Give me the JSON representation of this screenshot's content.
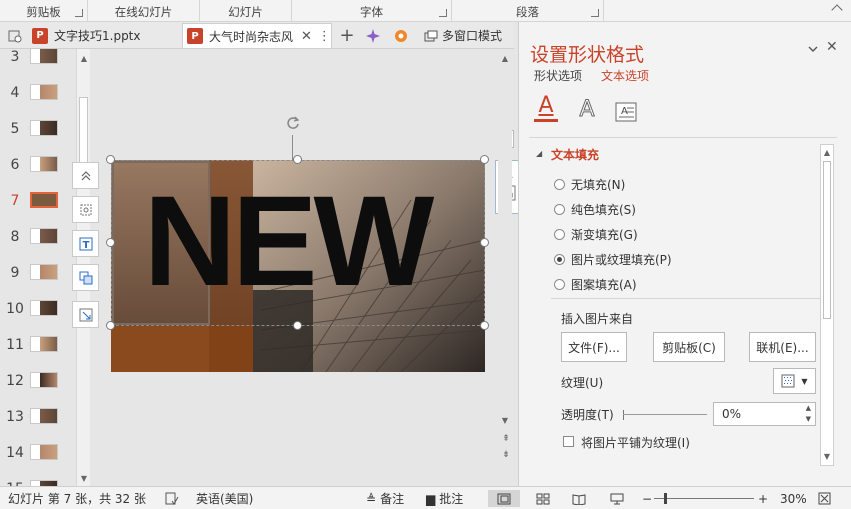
{
  "ribbon": {
    "groups": [
      "剪贴板",
      "在线幻灯片",
      "幻灯片",
      "字体",
      "段落"
    ]
  },
  "tabs": [
    {
      "label": "文字技巧1.pptx",
      "badge": "P"
    },
    {
      "label": "大气时尚杂志风",
      "badge": "P"
    }
  ],
  "toolbar": {
    "multi_window": "多窗口模式",
    "add_icon": "+"
  },
  "thumbnails": {
    "numbers": [
      "3",
      "4",
      "5",
      "6",
      "7",
      "8",
      "9",
      "10",
      "11",
      "12",
      "13",
      "14",
      "15"
    ],
    "selected": "7"
  },
  "slide": {
    "headline": "NEW"
  },
  "float_tools": {
    "text_a": "A"
  },
  "pane": {
    "title": "设置形状格式",
    "tab_shape": "形状选项",
    "tab_text": "文本选项",
    "icon_a1": "A",
    "icon_a2": "A",
    "section": "文本填充",
    "options": [
      "无填充(N)",
      "纯色填充(S)",
      "渐变填充(G)",
      "图片或纹理填充(P)",
      "图案填充(A)"
    ],
    "selected_option": 3,
    "insert_from": "插入图片来自",
    "btn_file": "文件(F)...",
    "btn_clipboard": "剪贴板(C)",
    "btn_online": "联机(E)...",
    "texture_label": "纹理(U)",
    "transparency_label": "透明度(T)",
    "transparency_value": "0%",
    "tile_label": "将图片平铺为纹理(I)"
  },
  "status": {
    "slide_info": "幻灯片 第 7 张，共 32 张",
    "language": "英语(美国)",
    "notes": "备注",
    "comments": "批注",
    "zoom": "30%"
  },
  "colors": {
    "accent": "#c9432a",
    "slide_brown": "#8a4a1e",
    "selected_thumb_border": "#e4643a"
  }
}
